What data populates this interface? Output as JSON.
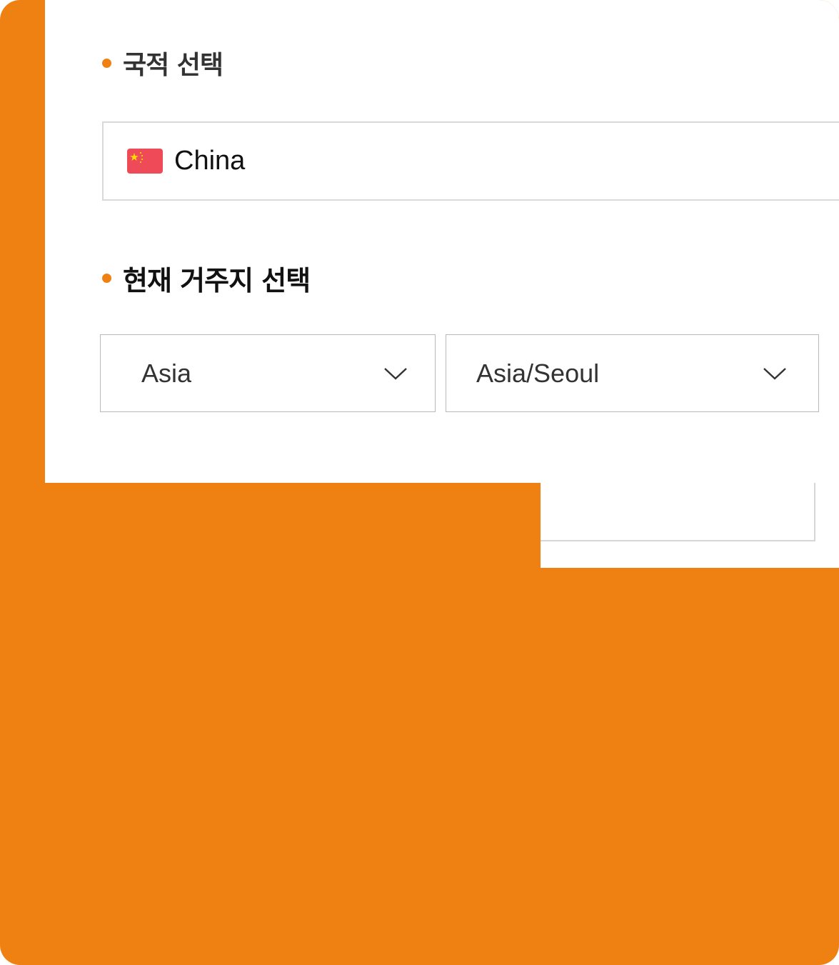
{
  "nationality": {
    "title": "국적 선택",
    "selected_country": "China",
    "flag_icon": "china-flag-icon"
  },
  "residence": {
    "title": "현재 거주지 선택",
    "region_select": {
      "value": "Asia",
      "icon": "chevron-down-icon"
    },
    "timezone_select": {
      "value": "Asia/Seoul",
      "icon": "chevron-down-icon"
    }
  },
  "colors": {
    "accent": "#ef8112",
    "flag_red": "#ee4a57",
    "border": "#d9d9d9"
  }
}
